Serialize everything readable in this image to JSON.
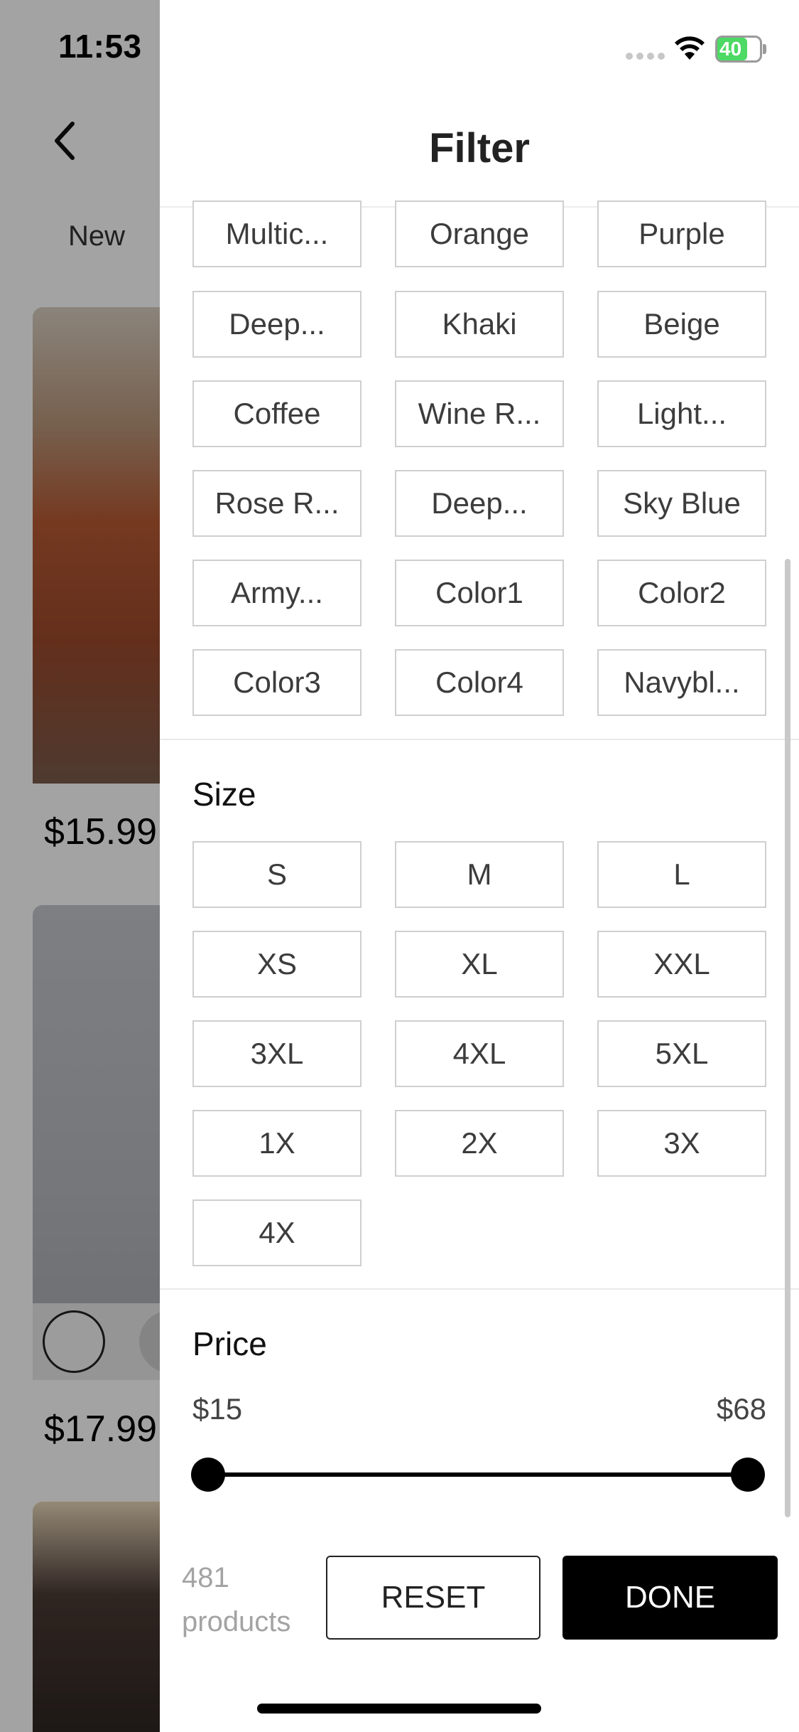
{
  "status_bar": {
    "time": "11:53",
    "battery_level": "40",
    "battery_fill_fraction": 0.4
  },
  "background": {
    "tab_label": "New",
    "prices": [
      "$15.99",
      "$17.99"
    ]
  },
  "filter": {
    "title": "Filter",
    "colors": [
      "Multic...",
      "Orange",
      "Purple",
      "Deep...",
      "Khaki",
      "Beige",
      "Coffee",
      "Wine R...",
      "Light...",
      "Rose R...",
      "Deep...",
      "Sky Blue",
      "Army...",
      "Color1",
      "Color2",
      "Color3",
      "Color4",
      "Navybl..."
    ],
    "size_title": "Size",
    "sizes": [
      "S",
      "M",
      "L",
      "XS",
      "XL",
      "XXL",
      "3XL",
      "4XL",
      "5XL",
      "1X",
      "2X",
      "3X",
      "4X"
    ],
    "price_title": "Price",
    "price_min": "$15",
    "price_max": "$68",
    "slider_min_fraction": 0.0,
    "slider_max_fraction": 1.0
  },
  "footer": {
    "product_count": "481 products",
    "reset_label": "RESET",
    "done_label": "DONE"
  },
  "icons": {
    "back": "chevron-left-icon",
    "signal": "cellular-signal-icon",
    "wifi": "wifi-icon",
    "battery": "battery-charging-icon"
  }
}
